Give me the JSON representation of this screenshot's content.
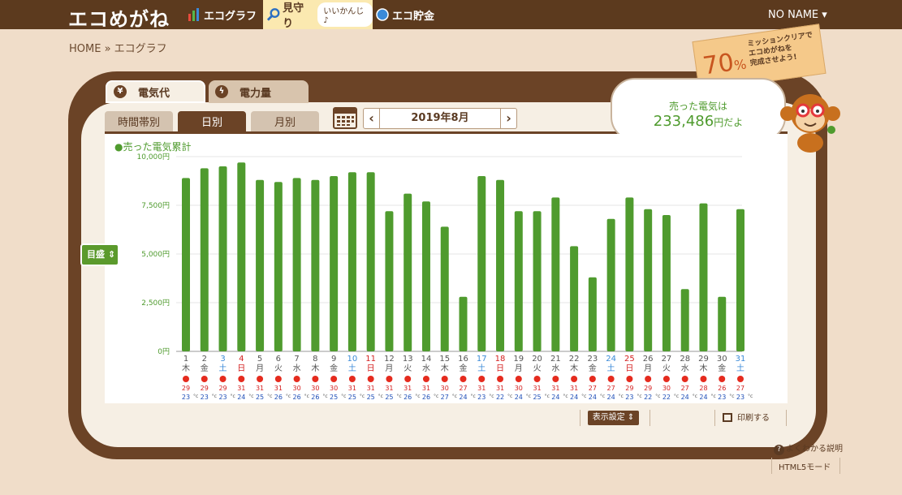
{
  "header": {
    "logo": "エコめがね",
    "nav": [
      {
        "label": "エコグラフ"
      },
      {
        "label": "見守り",
        "badge": "いいかんじ♪"
      },
      {
        "label": "エコ貯金"
      }
    ],
    "user": "NO NAME ▾"
  },
  "breadcrumb": "HOME » エコグラフ",
  "mission": {
    "percent": "70",
    "percent_unit": "%",
    "text": [
      "ミッションクリアで",
      "エコめがねを",
      "完成させよう!"
    ]
  },
  "tabs": [
    {
      "label": "電気代",
      "icon": "yen-icon"
    },
    {
      "label": "電力量",
      "icon": "lightning-icon"
    }
  ],
  "subtabs": [
    "時間帯別",
    "日別",
    "月別"
  ],
  "date": {
    "prev": "‹",
    "label": "2019年8月",
    "next": "›"
  },
  "summary": {
    "line1": "売った電気は",
    "amount": "233,486",
    "unit": "円だよ"
  },
  "meyasu": "目盛 ⇕",
  "footer": {
    "display_settings": "表示設定 ⇕",
    "print": "印刷する",
    "help": "よくわかる説明",
    "html5": "HTML5モード"
  },
  "colors": {
    "bar": "#4f9b2e",
    "brown": "#6b4326",
    "sat": "#3b8ad8",
    "sun": "#d42020",
    "hi": "#d42020",
    "lo": "#1f4fb8"
  },
  "chart_data": {
    "type": "bar",
    "legend": "●売った電気累計",
    "ylim": [
      0,
      10000
    ],
    "yticks": [
      "0円",
      "2,500円",
      "5,000円",
      "7,500円",
      "10,000円"
    ],
    "categories": [
      "1",
      "2",
      "3",
      "4",
      "5",
      "6",
      "7",
      "8",
      "9",
      "10",
      "11",
      "12",
      "13",
      "14",
      "15",
      "16",
      "17",
      "18",
      "19",
      "20",
      "21",
      "22",
      "23",
      "24",
      "25",
      "26",
      "27",
      "28",
      "29",
      "30",
      "31"
    ],
    "weekdays": [
      "木",
      "金",
      "土",
      "日",
      "月",
      "火",
      "水",
      "木",
      "金",
      "土",
      "日",
      "月",
      "火",
      "水",
      "木",
      "金",
      "土",
      "日",
      "月",
      "火",
      "水",
      "木",
      "金",
      "土",
      "日",
      "月",
      "火",
      "水",
      "木",
      "金",
      "土"
    ],
    "values": [
      8900,
      9400,
      9500,
      9700,
      8800,
      8700,
      8900,
      8800,
      9000,
      9200,
      9200,
      7200,
      8100,
      7700,
      6400,
      2800,
      9000,
      8800,
      7200,
      7200,
      7900,
      5400,
      3800,
      6800,
      7900,
      7300,
      7000,
      3200,
      7600,
      2800,
      7300
    ],
    "hi": [
      "29",
      "29",
      "29",
      "31",
      "31",
      "31",
      "30",
      "30",
      "30",
      "31",
      "31",
      "31",
      "31",
      "31",
      "30",
      "27",
      "31",
      "31",
      "30",
      "31",
      "31",
      "31",
      "27",
      "27",
      "29",
      "29",
      "30",
      "27",
      "28",
      "26",
      "27"
    ],
    "lo": [
      "23",
      "23",
      "23",
      "24",
      "25",
      "26",
      "26",
      "26",
      "25",
      "25",
      "25",
      "25",
      "26",
      "26",
      "27",
      "24",
      "23",
      "22",
      "24",
      "25",
      "24",
      "24",
      "24",
      "24",
      "23",
      "22",
      "22",
      "24",
      "24",
      "23",
      "23"
    ],
    "deg": "°c"
  }
}
